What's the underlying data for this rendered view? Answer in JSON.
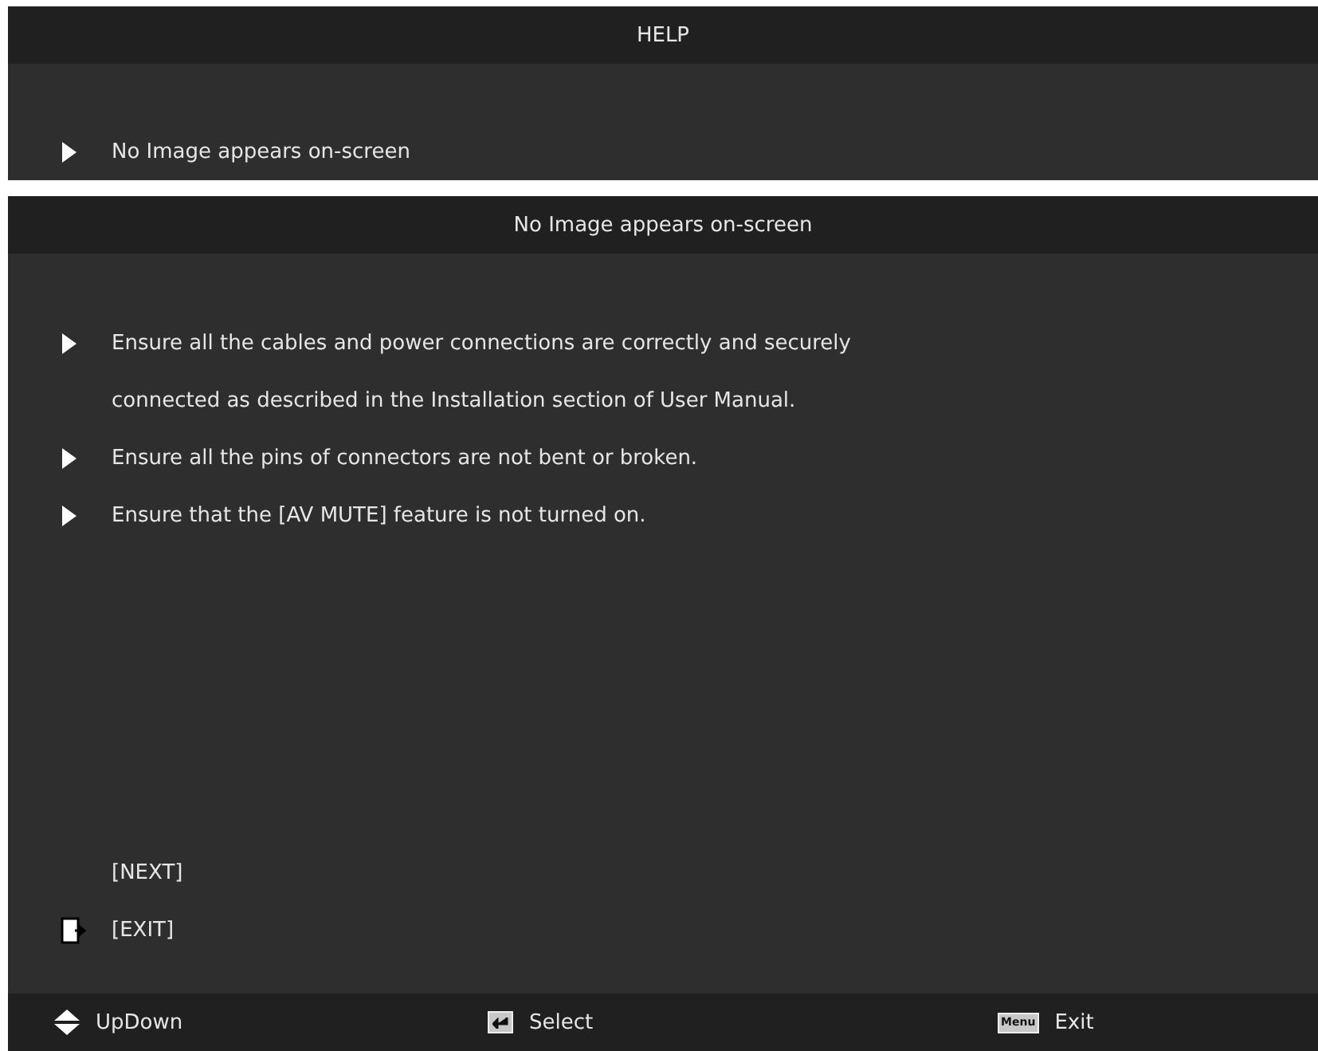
{
  "help_panel": {
    "title": "HELP",
    "items": [
      {
        "label": "No Image appears on-screen"
      }
    ]
  },
  "detail_panel": {
    "title": "No Image appears on-screen",
    "tips": [
      {
        "lines": [
          "Ensure all the cables and power connections are correctly and securely",
          "connected as described in the Installation section of User Manual."
        ]
      },
      {
        "lines": [
          "Ensure all the pins of connectors are not bent or broken."
        ]
      },
      {
        "lines": [
          "Ensure that the [AV MUTE] feature is not turned on."
        ]
      }
    ],
    "actions": [
      {
        "label": "[NEXT]",
        "selected": false
      },
      {
        "label": "[EXIT]",
        "selected": true
      }
    ]
  },
  "footer": [
    {
      "kind": "updown",
      "label": "UpDown"
    },
    {
      "kind": "enter",
      "label": "Select"
    },
    {
      "kind": "menu",
      "key": "Menu",
      "label": "Exit"
    }
  ]
}
